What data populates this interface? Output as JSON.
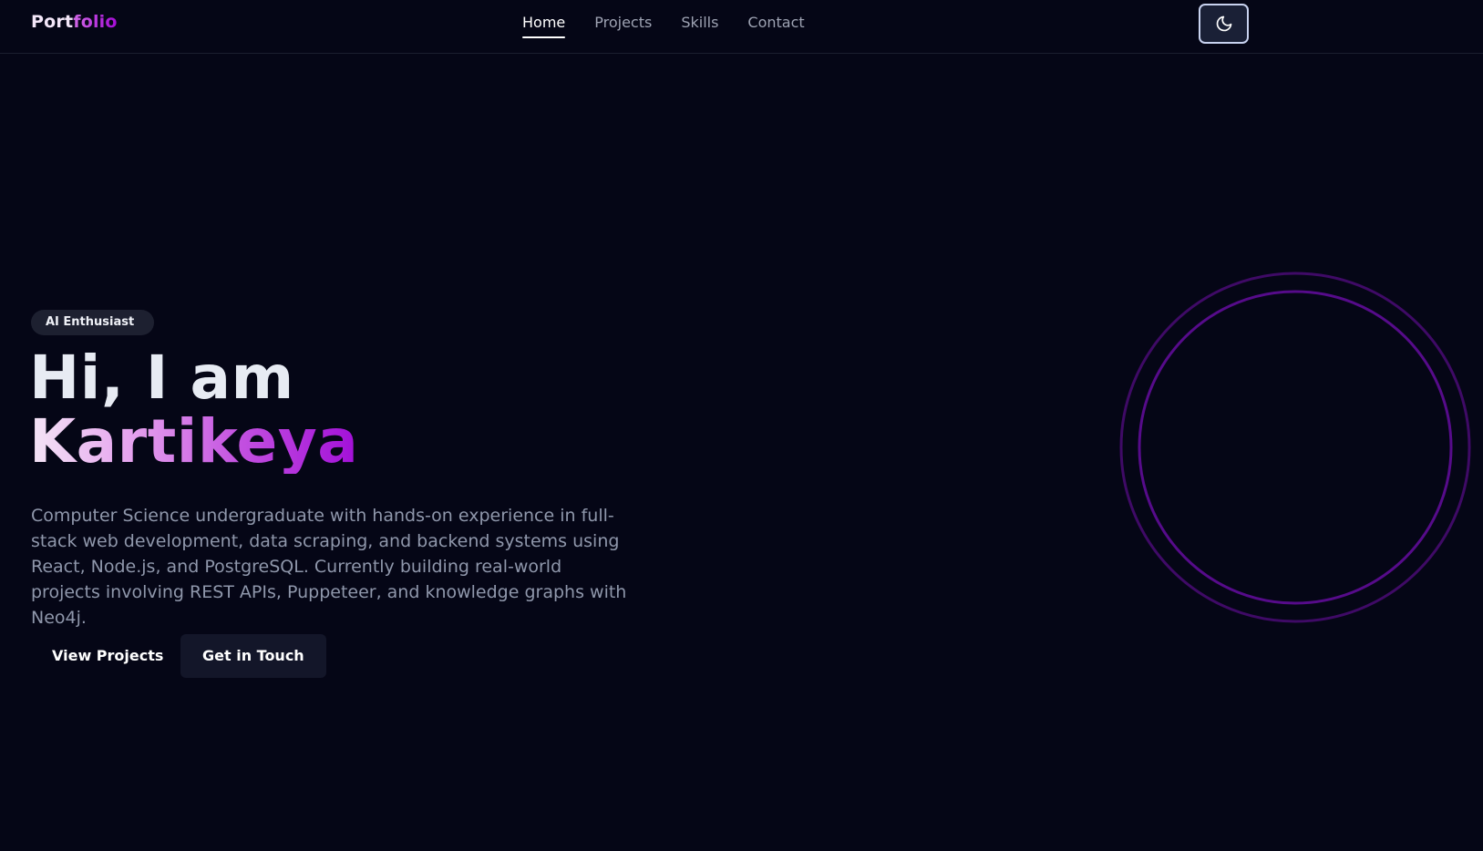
{
  "brand": {
    "logo_part1": "Port",
    "logo_part2": "folio"
  },
  "nav": {
    "items": [
      {
        "label": "Home",
        "active": true
      },
      {
        "label": "Projects",
        "active": false
      },
      {
        "label": "Skills",
        "active": false
      },
      {
        "label": "Contact",
        "active": false
      }
    ],
    "theme_toggle_icon": "moon-icon"
  },
  "hero": {
    "badge": "AI Enthusiast",
    "greeting": "Hi, I am",
    "name": "Kartikeya",
    "description": "Computer Science undergraduate with hands-on experience in full-stack web development, data scraping, and backend systems using React, Node.js, and PostgreSQL. Currently building real-world projects involving REST APIs, Puppeteer, and knowledge graphs with Neo4j.",
    "primary_button": "View Projects",
    "secondary_button": "Get in Touch"
  },
  "colors": {
    "background": "#050616",
    "accent": "#a40ad6",
    "ring": "#4c0a7a"
  }
}
